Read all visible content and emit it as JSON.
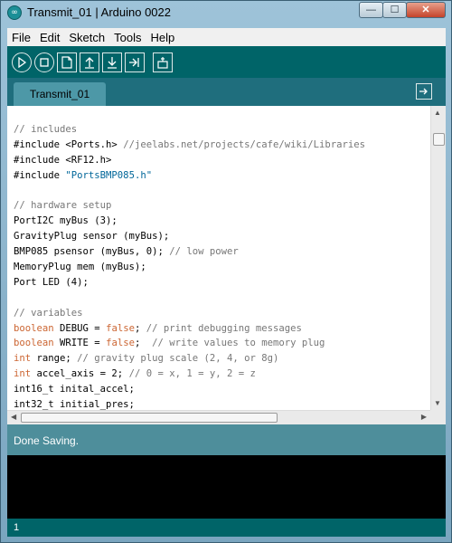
{
  "window": {
    "title": "Transmit_01 | Arduino 0022",
    "icon": "arduino-logo-icon",
    "controls": {
      "minimize_label": "—",
      "maximize_label": "☐",
      "close_label": "✕"
    }
  },
  "menu": {
    "items": [
      "File",
      "Edit",
      "Sketch",
      "Tools",
      "Help"
    ]
  },
  "toolbar": {
    "buttons": [
      "verify-icon",
      "stop-icon",
      "new-icon",
      "open-icon",
      "save-icon",
      "upload-icon",
      "serial-monitor-icon"
    ],
    "background": "#006468"
  },
  "tabs": {
    "active": "Transmit_01",
    "tab_menu_icon": "tab-menu-icon"
  },
  "editor": {
    "lines": [
      [
        {
          "t": "// includes",
          "c": "cmt"
        }
      ],
      [
        {
          "t": "#include <Ports.h> ",
          "c": ""
        },
        {
          "t": "//jeelabs.net/projects/cafe/wiki/Libraries",
          "c": "cmt"
        }
      ],
      [
        {
          "t": "#include <RF12.h>",
          "c": ""
        }
      ],
      [
        {
          "t": "#include ",
          "c": ""
        },
        {
          "t": "\"PortsBMP085.h\"",
          "c": "str"
        }
      ],
      [
        {
          "t": "",
          "c": ""
        }
      ],
      [
        {
          "t": "// hardware setup",
          "c": "cmt"
        }
      ],
      [
        {
          "t": "PortI2C myBus (3);",
          "c": ""
        }
      ],
      [
        {
          "t": "GravityPlug sensor (myBus);",
          "c": ""
        }
      ],
      [
        {
          "t": "BMP085 psensor (myBus, 0); ",
          "c": ""
        },
        {
          "t": "// low power",
          "c": "cmt"
        }
      ],
      [
        {
          "t": "MemoryPlug mem (myBus);",
          "c": ""
        }
      ],
      [
        {
          "t": "Port LED (4);",
          "c": ""
        }
      ],
      [
        {
          "t": "",
          "c": ""
        }
      ],
      [
        {
          "t": "// variables",
          "c": "cmt"
        }
      ],
      [
        {
          "t": "boolean",
          "c": "kw"
        },
        {
          "t": " DEBUG = ",
          "c": ""
        },
        {
          "t": "false",
          "c": "kw"
        },
        {
          "t": "; ",
          "c": ""
        },
        {
          "t": "// print debugging messages",
          "c": "cmt"
        }
      ],
      [
        {
          "t": "boolean",
          "c": "kw"
        },
        {
          "t": " WRITE = ",
          "c": ""
        },
        {
          "t": "false",
          "c": "kw"
        },
        {
          "t": ";  ",
          "c": ""
        },
        {
          "t": "// write values to memory plug",
          "c": "cmt"
        }
      ],
      [
        {
          "t": "int",
          "c": "kw"
        },
        {
          "t": " range; ",
          "c": ""
        },
        {
          "t": "// gravity plug scale (2, 4, or 8g)",
          "c": "cmt"
        }
      ],
      [
        {
          "t": "int",
          "c": "kw"
        },
        {
          "t": " accel_axis = 2; ",
          "c": ""
        },
        {
          "t": "// 0 = x, 1 = y, 2 = z",
          "c": "cmt"
        }
      ],
      [
        {
          "t": "int16_t inital_accel;",
          "c": ""
        }
      ],
      [
        {
          "t": "int32_t initial_pres;",
          "c": ""
        }
      ]
    ],
    "colors": {
      "comment": "#777777",
      "keyword": "#cc6633",
      "string": "#006699"
    }
  },
  "status": {
    "message": "Done Saving.",
    "background": "#4e8e9b"
  },
  "footer": {
    "line_number": "1"
  }
}
